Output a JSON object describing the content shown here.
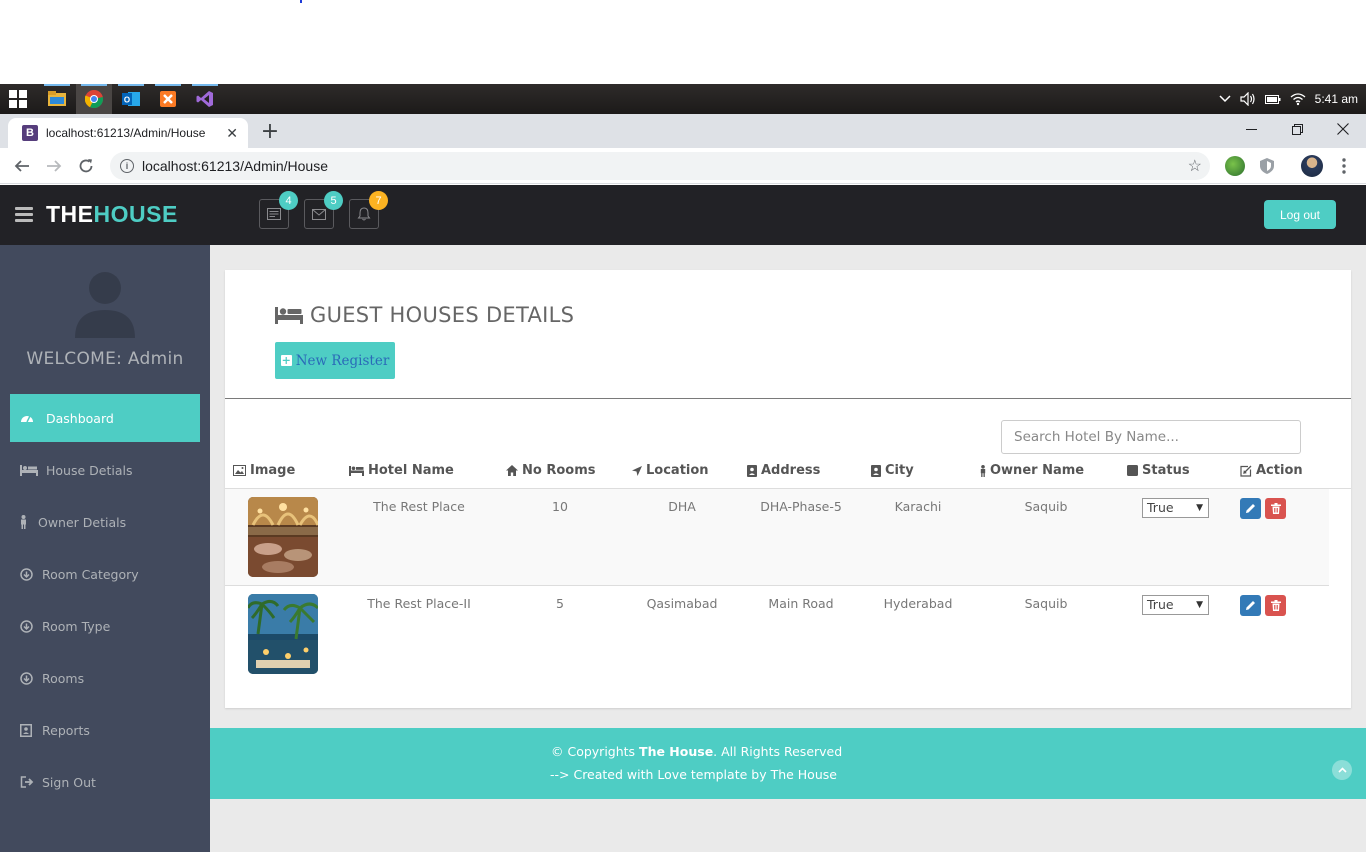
{
  "browser": {
    "tab_title": "localhost:61213/Admin/House",
    "tab_favicon": "B",
    "url": "localhost:61213/Admin/House"
  },
  "taskbar": {
    "clock": "5:41 am",
    "apps": [
      "windows-start-icon",
      "file-explorer-icon",
      "chrome-icon",
      "outlook-icon",
      "xampp-icon",
      "visual-studio-icon"
    ]
  },
  "header": {
    "logo_part1": "THE",
    "logo_part2": "HOUSE",
    "badges": {
      "tasks": "4",
      "messages": "5",
      "notifications": "7"
    },
    "logout_label": "Log out"
  },
  "sidebar": {
    "welcome": "WELCOME: Admin",
    "items": [
      {
        "label": "Dashboard",
        "icon": "dashboard-icon"
      },
      {
        "label": "House Detials",
        "icon": "bed-icon"
      },
      {
        "label": "Owner Detials",
        "icon": "person-icon"
      },
      {
        "label": "Room Category",
        "icon": "circle-down-icon"
      },
      {
        "label": "Room Type",
        "icon": "circle-down-icon"
      },
      {
        "label": "Rooms",
        "icon": "circle-down-icon"
      },
      {
        "label": "Reports",
        "icon": "report-icon"
      },
      {
        "label": "Sign Out",
        "icon": "sign-out-icon"
      }
    ]
  },
  "main": {
    "title": "GUEST HOUSES DETAILS",
    "new_button": "New Register",
    "search_placeholder": "Search Hotel By Name...",
    "columns": [
      "Image",
      "Hotel Name",
      "No Rooms",
      "Location",
      "Address",
      "City",
      "Owner Name",
      "Status",
      "Action"
    ],
    "rows": [
      {
        "hotel_name": "The Rest Place",
        "rooms": "10",
        "location": "DHA",
        "address": "DHA-Phase-5",
        "city": "Karachi",
        "owner": "Saquib",
        "status": "True"
      },
      {
        "hotel_name": "The Rest Place-II",
        "rooms": "5",
        "location": "Qasimabad",
        "address": "Main Road",
        "city": "Hyderabad",
        "owner": "Saquib",
        "status": "True"
      }
    ]
  },
  "footer": {
    "line1_prefix": "© Copyrights ",
    "line1_brand": "The House",
    "line1_suffix": ". All Rights Reserved",
    "line2": "--> Created with Love template by The House"
  },
  "colors": {
    "accent": "#4ecdc4",
    "header_bg": "#222226",
    "sidebar_bg": "#424a5d"
  }
}
